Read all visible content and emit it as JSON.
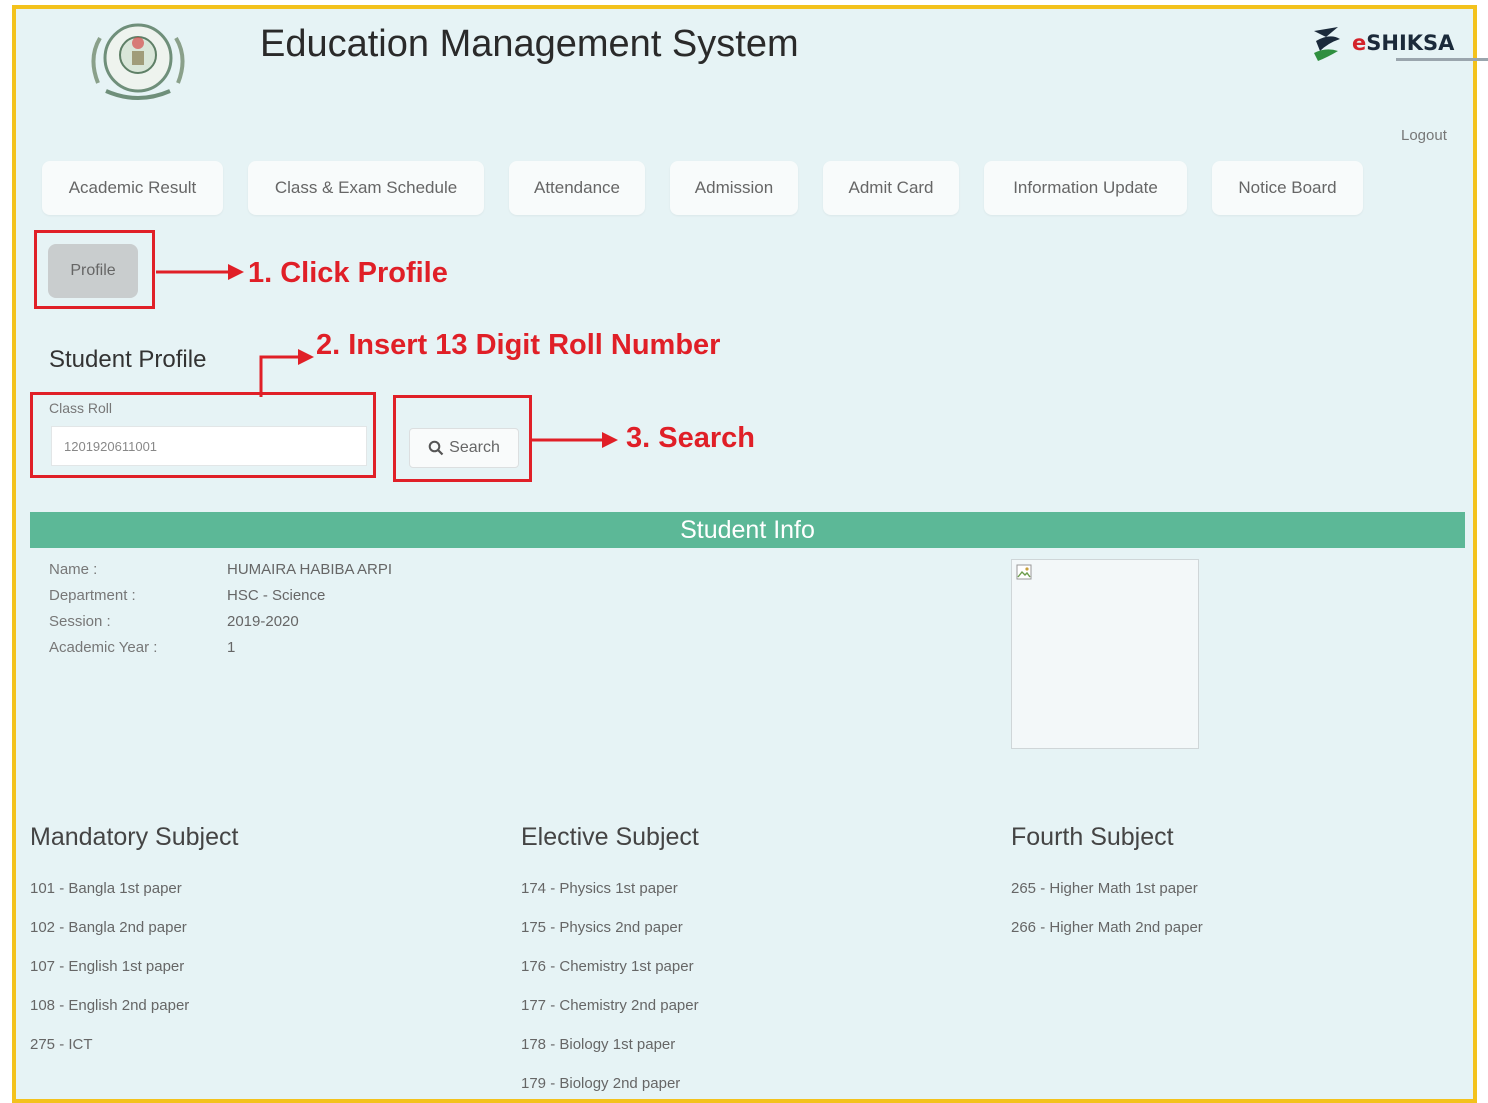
{
  "header": {
    "title": "Education Management System",
    "brand": {
      "prefix": "e",
      "name": "SHIKSA"
    },
    "logout_label": "Logout"
  },
  "nav": {
    "items": [
      {
        "label": "Academic Result"
      },
      {
        "label": "Class & Exam Schedule"
      },
      {
        "label": "Attendance"
      },
      {
        "label": "Admission"
      },
      {
        "label": "Admit Card"
      },
      {
        "label": "Information Update"
      },
      {
        "label": "Notice Board"
      }
    ]
  },
  "profile": {
    "button_label": "Profile",
    "section_title": "Student Profile",
    "class_roll_label": "Class Roll",
    "class_roll_value": "1201920611001",
    "search_label": "Search"
  },
  "callouts": {
    "step1": "1. Click Profile",
    "step2": "2. Insert 13 Digit Roll Number",
    "step3": "3. Search",
    "color": "#e01f27"
  },
  "student_info": {
    "bar_title": "Student Info",
    "fields": [
      {
        "label": "Name :",
        "value": "HUMAIRA HABIBA ARPI"
      },
      {
        "label": "Department :",
        "value": "HSC - Science"
      },
      {
        "label": "Session :",
        "value": "2019-2020"
      },
      {
        "label": "Academic Year :",
        "value": "1"
      }
    ]
  },
  "subjects": {
    "mandatory": {
      "title": "Mandatory Subject",
      "items": [
        "101 - Bangla 1st paper",
        "102 - Bangla 2nd paper",
        "107 - English 1st paper",
        "108 - English 2nd paper",
        "275 - ICT"
      ]
    },
    "elective": {
      "title": "Elective Subject",
      "items": [
        "174 - Physics 1st paper",
        "175 - Physics 2nd paper",
        "176 - Chemistry 1st paper",
        "177 - Chemistry 2nd paper",
        "178 - Biology 1st paper",
        "179 - Biology 2nd paper"
      ]
    },
    "fourth": {
      "title": "Fourth Subject",
      "items": [
        "265 - Higher Math 1st paper",
        "266 - Higher Math 2nd paper"
      ]
    }
  },
  "colors": {
    "frame_border": "#f3c21d",
    "page_bg": "#e6f3f5",
    "info_bar": "#5cb897",
    "annotation_red": "#e01f27"
  }
}
